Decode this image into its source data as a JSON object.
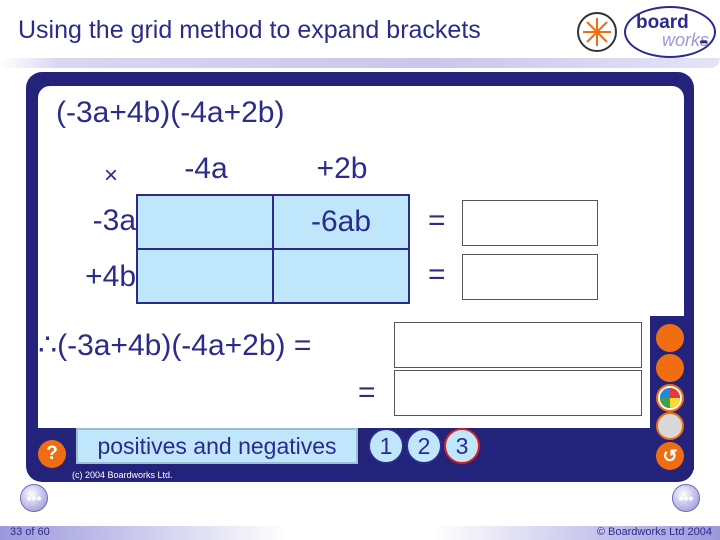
{
  "header": {
    "title": "Using the grid method to expand brackets"
  },
  "logo": {
    "word1": "board",
    "word2": "works",
    "dots": "•••"
  },
  "expression": "(-3a+4b)(-4a+2b)",
  "grid": {
    "corner": "×",
    "column_headers": [
      "-4a",
      "+2b"
    ],
    "row_headers": [
      "-3a",
      "+4b"
    ],
    "cells": [
      [
        "",
        "-6ab"
      ],
      [
        "",
        ""
      ]
    ],
    "row_equals": [
      "=",
      "="
    ]
  },
  "therefore": {
    "lhs": "∴(-3a+4b)(-4a+2b) =",
    "eq2": "="
  },
  "controls": {
    "help_label": "?",
    "mode_label": "positives and negatives",
    "steps": [
      "1",
      "2",
      "3"
    ],
    "active_step": "3",
    "undo_label": "↺",
    "nav_prev": "•••",
    "nav_next": "•••"
  },
  "tools": [
    "pen-icon",
    "eraser-icon",
    "color-wheel-icon",
    "bin-icon"
  ],
  "footer": {
    "slide_number": "33 of 60",
    "copyright": "© Boardworks Ltd 2004",
    "inner_copyright": "(c) 2004 Boardworks Ltd."
  },
  "colors": {
    "navy": "#23237b",
    "text": "#2b2b8c",
    "cell": "#bfe6fb",
    "accent": "#f06d12",
    "active": "#d61e1e"
  }
}
